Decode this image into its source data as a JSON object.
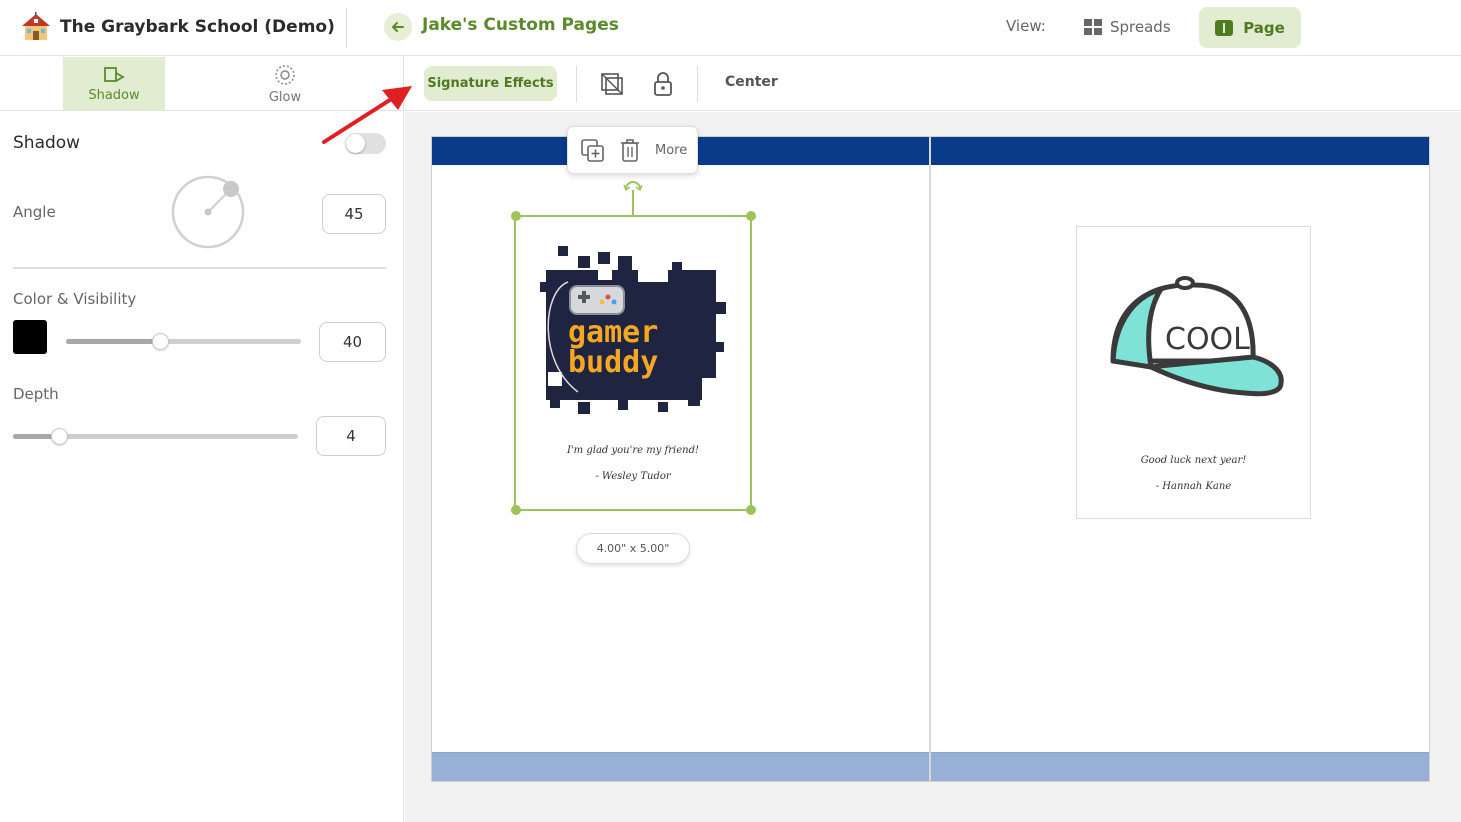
{
  "header": {
    "school_name": "The Graybark School (Demo)",
    "pages_title": "Jake's Custom Pages",
    "view_label": "View:",
    "spreads_label": "Spreads",
    "page_label": "Page"
  },
  "effects_tabs": [
    {
      "label": "Shadow",
      "icon": "shadow-icon",
      "active": true
    },
    {
      "label": "Glow",
      "icon": "glow-icon",
      "active": false
    }
  ],
  "shadow_panel": {
    "heading": "Shadow",
    "enabled": false,
    "angle_label": "Angle",
    "angle_value": "45",
    "color_visibility_label": "Color & Visibility",
    "color": "#000000",
    "visibility_value": "40",
    "visibility_fraction": 0.4,
    "depth_label": "Depth",
    "depth_value": "4",
    "depth_fraction": 0.16
  },
  "toolbar": {
    "signature_effects_label": "Signature Effects",
    "icons": [
      "layers-icon",
      "lock-icon"
    ],
    "center_label": "Center"
  },
  "context_menu": {
    "icons": [
      "duplicate-icon",
      "trash-icon"
    ],
    "more_label": "More"
  },
  "cards": [
    {
      "art_top": "gamer",
      "art_bottom": "buddy",
      "message": "I'm glad you're my friend!",
      "signature": "- Wesley Tudor",
      "size_label": "4.00\" x 5.00\""
    },
    {
      "art_text": "COOL",
      "message": "Good luck next year!",
      "signature": "- Hannah Kane"
    }
  ],
  "colors": {
    "accent_green": "#5a8a2a",
    "accent_bg": "#e2ecd0",
    "band_top": "#0a3a8a",
    "band_bottom": "#99b0d6",
    "annotation_arrow": "#e02020"
  }
}
